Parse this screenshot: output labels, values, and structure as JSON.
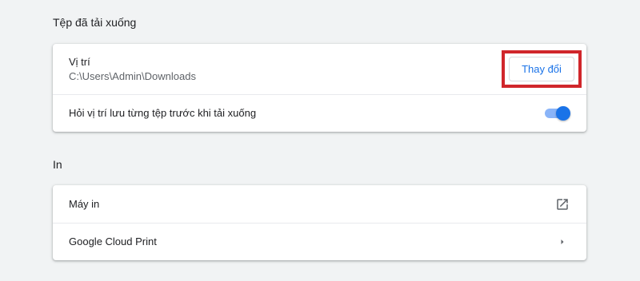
{
  "downloads": {
    "section_title": "Tệp đã tải xuống",
    "location_label": "Vị trí",
    "location_path": "C:\\Users\\Admin\\Downloads",
    "change_button": "Thay đổi",
    "ask_label": "Hỏi vị trí lưu từng tệp trước khi tải xuống",
    "ask_toggle_on": true
  },
  "print": {
    "section_title": "In",
    "printers_label": "Máy in",
    "cloud_print_label": "Google Cloud Print"
  },
  "icons": {
    "external_link": "open-in-new-icon",
    "arrow_right": "arrow-right-icon"
  },
  "colors": {
    "accent": "#1a73e8",
    "highlight_box": "#d0262b",
    "background": "#f1f3f4"
  }
}
